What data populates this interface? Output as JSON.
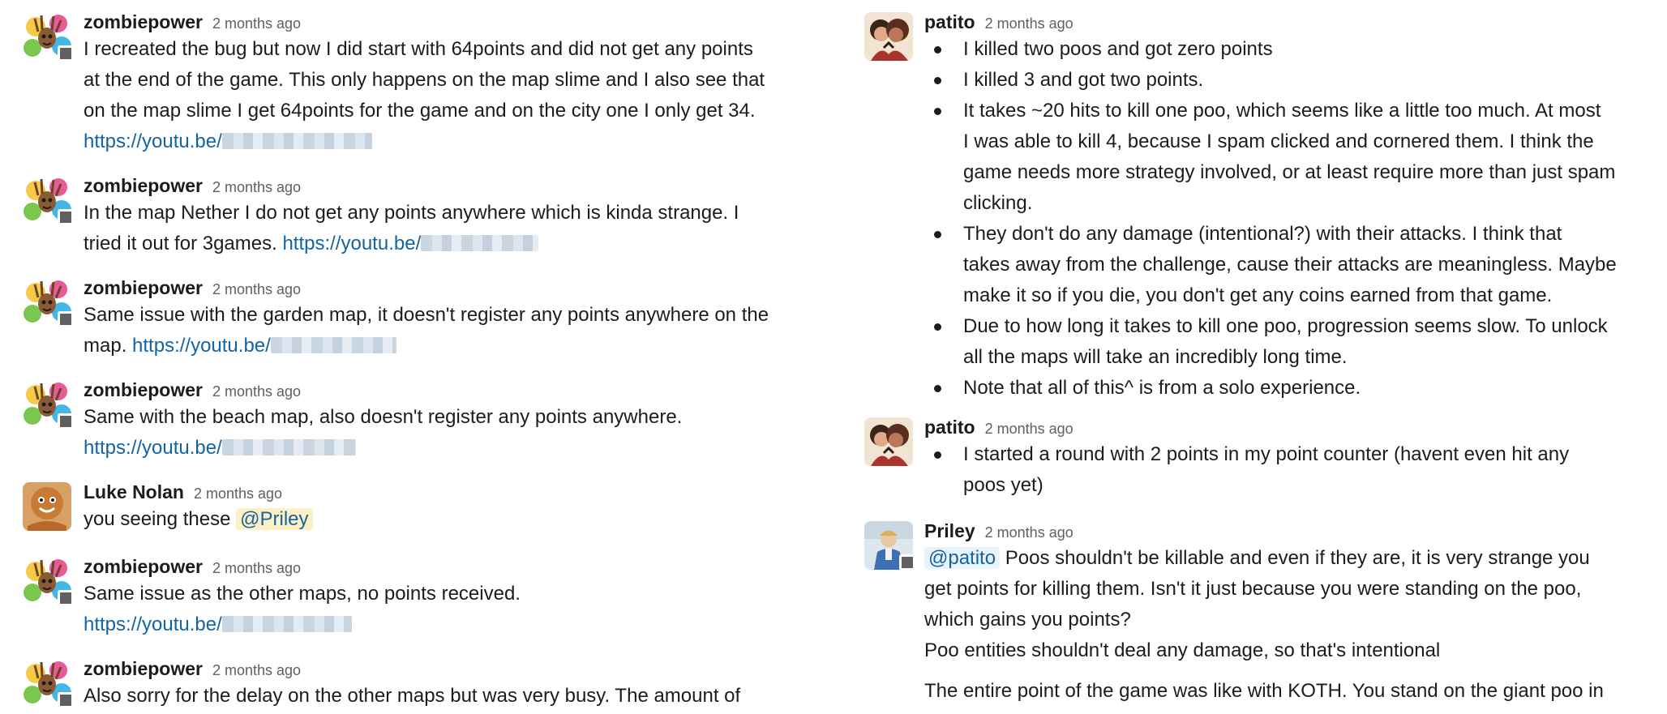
{
  "left_messages": [
    {
      "author": "zombiepower",
      "time": "2 months ago",
      "lines": [
        "I recreated the bug but now I did start with 64points and did not get any points",
        "at the end of the game. This only happens on the map slime and I also see that",
        "on the map slime I get 64points for the game and on the city one I only get 34."
      ],
      "link": "https://youtu.be/"
    },
    {
      "author": "zombiepower",
      "time": "2 months ago",
      "line1": "In the map Nether I do not get any points anywhere which is kinda strange. I",
      "line2_text": "tried it out for 3games.",
      "link": "https://youtu.be/"
    },
    {
      "author": "zombiepower",
      "time": "2 months ago",
      "line1": "Same issue with the garden map, it doesn't register any points anywhere on the",
      "line2_text": "map.",
      "link": "https://youtu.be/"
    },
    {
      "author": "zombiepower",
      "time": "2 months ago",
      "line1": "Same with the beach map, also doesn't register any points anywhere.",
      "link": "https://youtu.be/"
    },
    {
      "author": "Luke Nolan",
      "time": "2 months ago",
      "text": "you seeing these",
      "mention": "@Priley"
    },
    {
      "author": "zombiepower",
      "time": "2 months ago",
      "line1": "Same issue as the other maps, no points received.",
      "link": "https://youtu.be/"
    },
    {
      "author": "zombiepower",
      "time": "2 months ago",
      "line1": "Also sorry for the delay on the other maps but was very busy. The amount of"
    }
  ],
  "right_messages": [
    {
      "author": "patito",
      "time": "2 months ago",
      "bullets": [
        [
          "I killed two poos and got zero points"
        ],
        [
          "I killed 3 and got two points."
        ],
        [
          "It takes ~20 hits to kill one poo, which seems like a little too much.  At most",
          "I was able to kill 4, because I spam clicked and cornered them. I think the",
          "game needs more strategy involved, or at least require more than just spam",
          "clicking."
        ],
        [
          "They don't do any damage (intentional?) with their attacks. I think that",
          "takes away from the challenge, cause their attacks are meaningless. Maybe",
          "make it so if you die, you don't get any coins earned from that game."
        ],
        [
          "Due to how long it takes to kill one poo, progression seems slow. To unlock",
          "all the maps will take an incredibly long time."
        ],
        [
          "Note that all of this^ is from a solo experience."
        ]
      ]
    },
    {
      "author": "patito",
      "time": "2 months ago",
      "bullets": [
        [
          "I started a round with 2 points in my point counter (havent even hit any",
          "poos yet)"
        ]
      ]
    },
    {
      "author": "Priley",
      "time": "2 months ago",
      "mention": "@patito",
      "line1_rest": "Poos shouldn't be killable and even if they are, it is very strange you",
      "lines": [
        "get points for killing them. Isn't it just because you were standing on the poo,",
        "which gains you points?",
        "Poo entities shouldn't deal any damage, so that's intentional"
      ],
      "line_after": "The entire point of the game was like with KOTH. You stand on the giant poo in"
    }
  ]
}
